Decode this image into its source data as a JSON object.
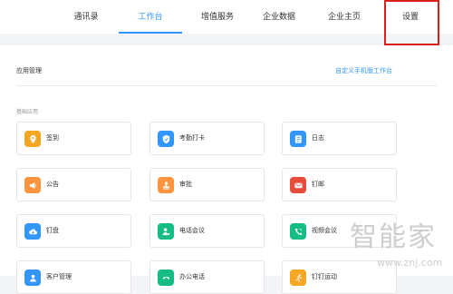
{
  "nav": {
    "tabs": [
      {
        "label": "通讯录"
      },
      {
        "label": "工作台"
      },
      {
        "label": "增值服务"
      },
      {
        "label": "企业数据"
      },
      {
        "label": "企业主页"
      },
      {
        "label": "设置"
      }
    ],
    "active_tab": "工作台"
  },
  "main": {
    "title": "应用管理",
    "customize_link": "自定义手机版工作台",
    "section_label": "基础应用",
    "apps": [
      {
        "label": "签到",
        "icon": "location-pin-icon",
        "color": "#f5a623"
      },
      {
        "label": "考勤打卡",
        "icon": "shield-check-icon",
        "color": "#3296fa"
      },
      {
        "label": "日志",
        "icon": "notepad-icon",
        "color": "#3296fa"
      },
      {
        "label": "公告",
        "icon": "megaphone-icon",
        "color": "#ff943e"
      },
      {
        "label": "审批",
        "icon": "stamp-icon",
        "color": "#ff943e"
      },
      {
        "label": "钉邮",
        "icon": "mail-icon",
        "color": "#e84c3d"
      },
      {
        "label": "钉盘",
        "icon": "cloud-icon",
        "color": "#3296fa"
      },
      {
        "label": "电话会议",
        "icon": "phone-person-icon",
        "color": "#15bc83"
      },
      {
        "label": "视频会议",
        "icon": "video-call-icon",
        "color": "#15bc83"
      },
      {
        "label": "客户管理",
        "icon": "user-icon",
        "color": "#3296fa"
      },
      {
        "label": "办公电话",
        "icon": "phone-icon",
        "color": "#15bc83"
      },
      {
        "label": "钉钉运动",
        "icon": "run-icon",
        "color": "#f5a623"
      }
    ]
  },
  "colors": {
    "accent": "#3296fa",
    "highlight_box": "#d9201c"
  },
  "watermark": {
    "cn": "智能家",
    "url": "www.znj.com"
  }
}
